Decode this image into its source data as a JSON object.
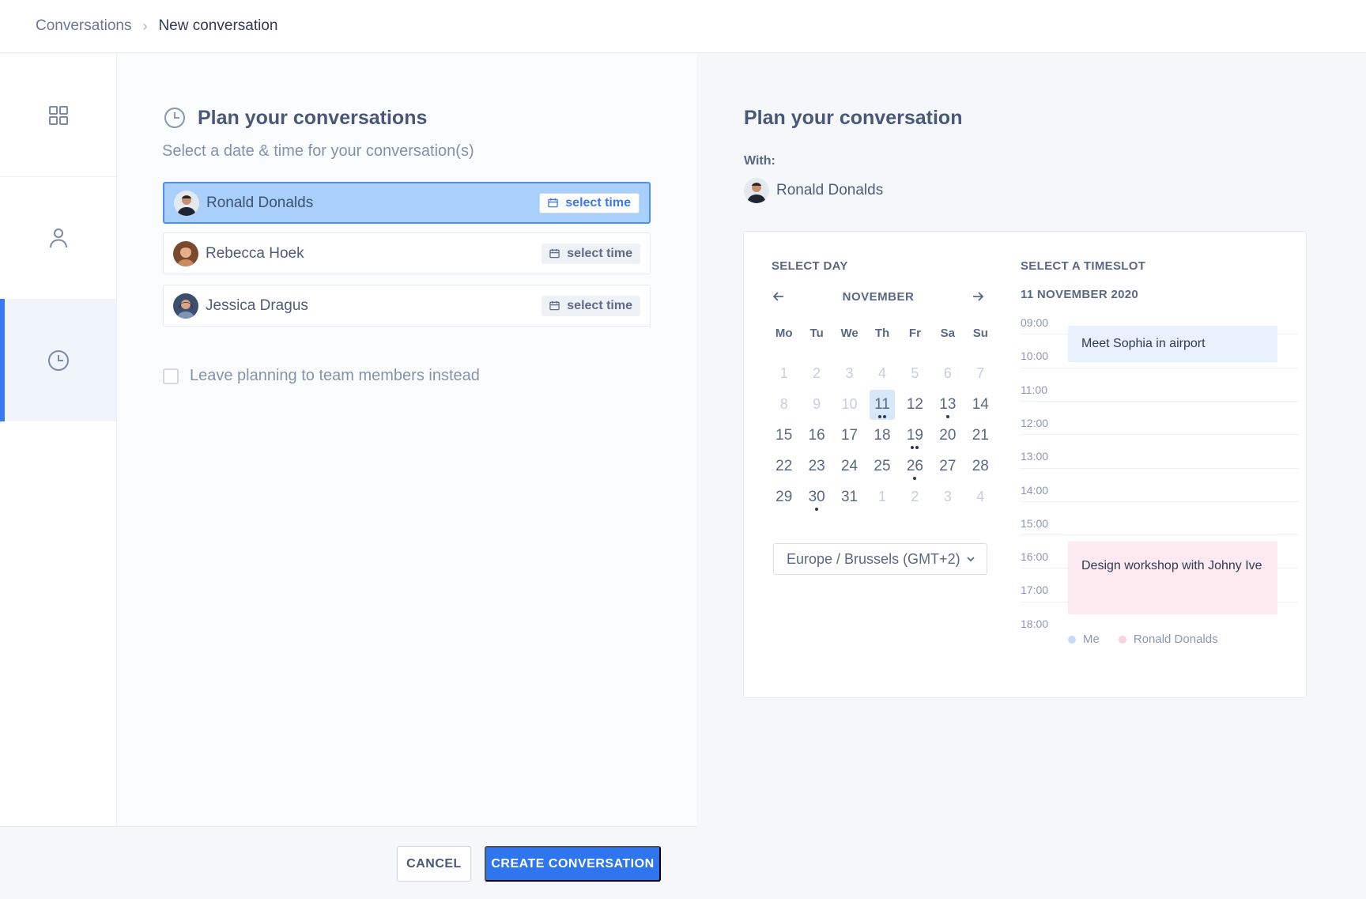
{
  "breadcrumb": {
    "parent": "Conversations",
    "separator": "›",
    "current": "New conversation"
  },
  "nav": {
    "items": [
      {
        "icon": "grid-icon"
      },
      {
        "icon": "user-icon"
      },
      {
        "icon": "clock-icon",
        "active": true
      }
    ]
  },
  "left": {
    "title": "Plan your conversations",
    "subtitle": "Select a date & time for your conversation(s)",
    "people": [
      {
        "name": "Ronald Donalds",
        "action": "select time",
        "selected": true
      },
      {
        "name": "Rebecca Hoek",
        "action": "select time",
        "selected": false
      },
      {
        "name": "Jessica Dragus",
        "action": "select time",
        "selected": false
      }
    ],
    "leave_planning_label": "Leave planning to team members instead",
    "leave_planning_checked": false
  },
  "footer": {
    "cancel_label": "CANCEL",
    "create_label": "CREATE CONVERSATION"
  },
  "right": {
    "title": "Plan your conversation",
    "with_label": "With:",
    "with_person": "Ronald Donalds",
    "calendar": {
      "select_day_heading": "SELECT DAY",
      "month": "NOVEMBER",
      "weekdays": [
        "Mo",
        "Tu",
        "We",
        "Th",
        "Fr",
        "Sa",
        "Su"
      ],
      "days": [
        {
          "n": "1",
          "muted": true
        },
        {
          "n": "2",
          "muted": true
        },
        {
          "n": "3",
          "muted": true
        },
        {
          "n": "4",
          "muted": true
        },
        {
          "n": "5",
          "muted": true
        },
        {
          "n": "6",
          "muted": true
        },
        {
          "n": "7",
          "muted": true
        },
        {
          "n": "8",
          "muted": true
        },
        {
          "n": "9",
          "muted": true
        },
        {
          "n": "10",
          "muted": true
        },
        {
          "n": "11",
          "selected": true,
          "dots": 2
        },
        {
          "n": "12"
        },
        {
          "n": "13",
          "dots": 1
        },
        {
          "n": "14"
        },
        {
          "n": "15"
        },
        {
          "n": "16"
        },
        {
          "n": "17"
        },
        {
          "n": "18"
        },
        {
          "n": "19",
          "dots": 2
        },
        {
          "n": "20"
        },
        {
          "n": "21"
        },
        {
          "n": "22"
        },
        {
          "n": "23"
        },
        {
          "n": "24"
        },
        {
          "n": "25"
        },
        {
          "n": "26",
          "dots": 1
        },
        {
          "n": "27"
        },
        {
          "n": "28"
        },
        {
          "n": "29"
        },
        {
          "n": "30",
          "dots": 1
        },
        {
          "n": "31"
        },
        {
          "n": "1",
          "muted": true
        },
        {
          "n": "2",
          "muted": true
        },
        {
          "n": "3",
          "muted": true
        },
        {
          "n": "4",
          "muted": true
        }
      ],
      "timezone": "Europe / Brussels (GMT+2)"
    },
    "timeslot": {
      "heading": "SELECT A TIMESLOT",
      "date": "11 NOVEMBER 2020",
      "hours": [
        "09:00",
        "10:00",
        "11:00",
        "12:00",
        "13:00",
        "14:00",
        "15:00",
        "16:00",
        "17:00",
        "18:00"
      ],
      "events": [
        {
          "title": "Meet Sophia in airport",
          "owner": "me"
        },
        {
          "title": "Design workshop with Johny Ive",
          "owner": "Ronald Donalds"
        }
      ],
      "legend": [
        {
          "label": "Me",
          "color": "#c7dcf6"
        },
        {
          "label": "Ronald Donalds",
          "color": "#f7d3de"
        }
      ]
    }
  },
  "colors": {
    "accent": "#2f75f0",
    "selected_row": "#a8d0fb",
    "event_me": "#e8f1fc",
    "event_other": "#fdeaf0"
  }
}
